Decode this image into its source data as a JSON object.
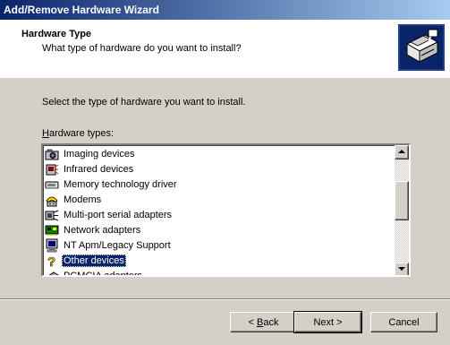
{
  "window": {
    "title": "Add/Remove Hardware Wizard"
  },
  "header": {
    "title": "Hardware Type",
    "subtitle": "What type of hardware do you want to install?",
    "logo_icon": "hardware-wizard-icon"
  },
  "content": {
    "instruction": "Select the type of hardware you want to install.",
    "list_label_accel": "H",
    "list_label_rest": "ardware types:"
  },
  "hardware_types": [
    {
      "label": "Imaging devices",
      "icon": "camera-icon",
      "selected": false
    },
    {
      "label": "Infrared devices",
      "icon": "infrared-icon",
      "selected": false
    },
    {
      "label": "Memory technology driver",
      "icon": "memory-card-icon",
      "selected": false
    },
    {
      "label": "Modems",
      "icon": "modem-icon",
      "selected": false
    },
    {
      "label": "Multi-port serial adapters",
      "icon": "serial-port-icon",
      "selected": false
    },
    {
      "label": "Network adapters",
      "icon": "network-adapter-icon",
      "selected": false
    },
    {
      "label": "NT Apm/Legacy Support",
      "icon": "computer-icon",
      "selected": false
    },
    {
      "label": "Other devices",
      "icon": "unknown-device-icon",
      "selected": true
    },
    {
      "label": "PCMCIA adapters",
      "icon": "pcmcia-icon",
      "selected": false
    }
  ],
  "buttons": {
    "back_accel": "B",
    "back_rest": "ack",
    "back_prefix": "< ",
    "next": "Next >",
    "cancel": "Cancel"
  }
}
